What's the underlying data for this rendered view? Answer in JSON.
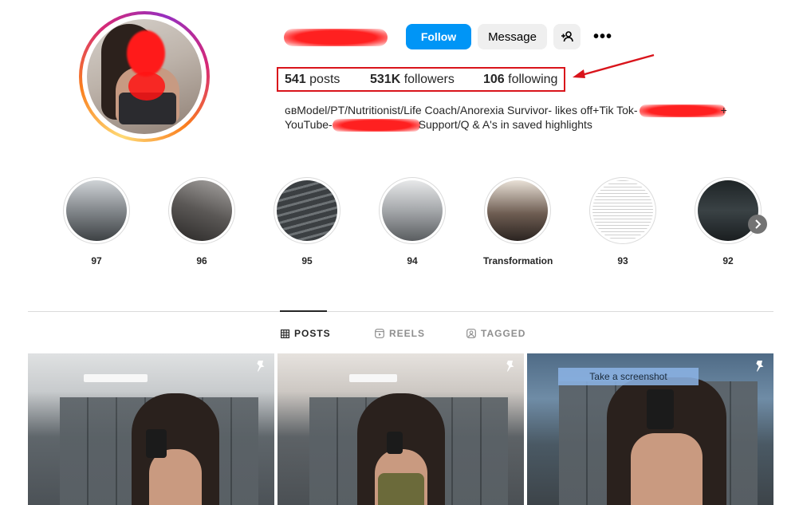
{
  "profile": {
    "username_redacted": true
  },
  "actions": {
    "follow_label": "Follow",
    "message_label": "Message",
    "add_user_icon": "person-add-icon",
    "more_label": "•••"
  },
  "stats": {
    "posts_count": "541",
    "posts_label": "posts",
    "followers_count": "531K",
    "followers_label": "followers",
    "following_count": "106",
    "following_label": "following"
  },
  "bio": {
    "line1_a": "ɢʙModel/PT/Nutritionist/Life Coach/Anorexia Survivor- likes off+Tik Tok-",
    "line1_b": "+",
    "line2_a": "YouTube-",
    "line2_b": "Support/Q & A's in saved highlights"
  },
  "highlights": [
    {
      "label": "97"
    },
    {
      "label": "96"
    },
    {
      "label": "95"
    },
    {
      "label": "94"
    },
    {
      "label": "Transformation"
    },
    {
      "label": "93"
    },
    {
      "label": "92"
    }
  ],
  "highlight_next_icon": "chevron-right-icon",
  "tabs": {
    "posts": "POSTS",
    "reels": "REELS",
    "tagged": "TAGGED"
  },
  "tooltip": {
    "screenshot": "Take a screenshot"
  },
  "colors": {
    "follow_blue": "#0095f6",
    "annotation_red": "#d9141b"
  }
}
